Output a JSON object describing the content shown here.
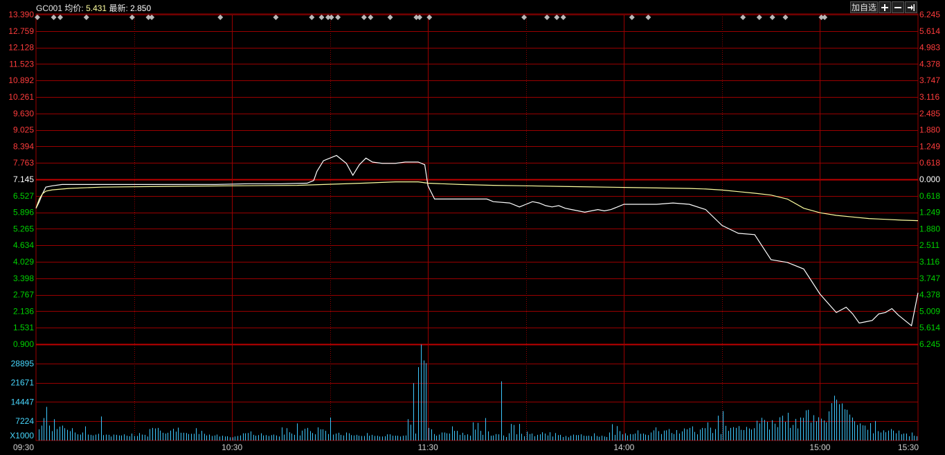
{
  "header": {
    "symbol": "GC001",
    "avg_label": "均价:",
    "avg_value": "5.431",
    "last_label": "最新:",
    "last_value": "2.850"
  },
  "toolbar": {
    "add_watchlist": "加自选",
    "zoom_in_icon": "plus-icon",
    "zoom_out_icon": "minus-icon",
    "goto_end_icon": "arrow-to-end-icon"
  },
  "colors": {
    "grid": "#9a0000",
    "up": "#ff3c3c",
    "down": "#00d200",
    "neutral": "#ffffff",
    "volume": "#3ec8ff",
    "volume_label": "#48d8ff",
    "price_line": "#ffffff",
    "avg_line": "#ffffa0"
  },
  "chart_data": [
    {
      "type": "line",
      "name": "intraday-price",
      "prev_close": 7.145,
      "ylim": [
        0.9,
        13.39
      ],
      "y_ticks_left": [
        "13.390",
        "12.759",
        "12.128",
        "11.523",
        "10.892",
        "10.261",
        "9.630",
        "9.025",
        "8.394",
        "7.763",
        "7.145",
        "6.527",
        "5.896",
        "5.265",
        "4.634",
        "4.029",
        "3.398",
        "2.767",
        "2.136",
        "1.531",
        "0.900"
      ],
      "y_ticks_right": [
        "6.245",
        "5.614",
        "4.983",
        "4.378",
        "3.747",
        "3.116",
        "2.485",
        "1.880",
        "1.249",
        "0.618",
        "0.000",
        "0.618",
        "1.249",
        "1.880",
        "2.511",
        "3.116",
        "3.747",
        "4.378",
        "5.009",
        "5.614",
        "6.245"
      ],
      "x_ticks": [
        "09:30",
        "10:30",
        "11:30",
        "14:00",
        "15:00",
        "15:30"
      ],
      "x_range_minutes": [
        0,
        270
      ],
      "series": [
        {
          "key": "price",
          "x": [
            0,
            1,
            2,
            3,
            5,
            8,
            12,
            18,
            25,
            35,
            45,
            55,
            65,
            75,
            83,
            85,
            86,
            88,
            92,
            95,
            97,
            99,
            101,
            103,
            106,
            110,
            113,
            115,
            117,
            119,
            120,
            122,
            125,
            130,
            135,
            138,
            140,
            145,
            148,
            150,
            152,
            154,
            156,
            158,
            160,
            162,
            164,
            166,
            168,
            170,
            172,
            174,
            176,
            178,
            180,
            182,
            184,
            186,
            188,
            190,
            195,
            200,
            205,
            210,
            215,
            220,
            225,
            230,
            235,
            240,
            245,
            248,
            250,
            252,
            254,
            256,
            258,
            260,
            262,
            264,
            266,
            268,
            270
          ],
          "y": [
            6.05,
            6.3,
            6.6,
            6.85,
            6.9,
            6.95,
            6.95,
            6.95,
            6.95,
            6.95,
            6.95,
            6.95,
            6.98,
            6.98,
            7.0,
            7.1,
            7.45,
            7.85,
            8.05,
            7.75,
            7.3,
            7.7,
            7.95,
            7.8,
            7.75,
            7.75,
            7.8,
            7.8,
            7.8,
            7.7,
            6.9,
            6.4,
            6.4,
            6.4,
            6.4,
            6.4,
            6.3,
            6.25,
            6.1,
            6.2,
            6.3,
            6.25,
            6.15,
            6.1,
            6.15,
            6.05,
            6.0,
            5.95,
            5.9,
            5.95,
            6.0,
            5.95,
            6.0,
            6.1,
            6.2,
            6.2,
            6.2,
            6.2,
            6.2,
            6.2,
            6.25,
            6.2,
            6.0,
            5.4,
            5.1,
            5.05,
            4.1,
            4.0,
            3.75,
            2.8,
            2.1,
            2.3,
            2.05,
            1.7,
            1.75,
            1.8,
            2.05,
            2.1,
            2.25,
            2.0,
            1.8,
            1.6,
            2.85
          ]
        },
        {
          "key": "average",
          "x": [
            0,
            1,
            2,
            3,
            5,
            10,
            20,
            40,
            60,
            80,
            100,
            110,
            115,
            117,
            120,
            130,
            140,
            150,
            160,
            170,
            180,
            190,
            200,
            205,
            210,
            215,
            220,
            225,
            230,
            235,
            240,
            245,
            250,
            255,
            260,
            265,
            270
          ],
          "y": [
            6.05,
            6.4,
            6.6,
            6.7,
            6.75,
            6.8,
            6.85,
            6.88,
            6.9,
            6.92,
            7.0,
            7.05,
            7.05,
            7.05,
            7.0,
            6.95,
            6.92,
            6.9,
            6.88,
            6.86,
            6.84,
            6.82,
            6.8,
            6.78,
            6.74,
            6.68,
            6.62,
            6.55,
            6.4,
            6.05,
            5.88,
            5.78,
            5.72,
            5.66,
            5.63,
            5.6,
            5.58
          ]
        }
      ]
    },
    {
      "type": "bar",
      "name": "volume",
      "ylabel": "X1000",
      "y_ticks": [
        "28895",
        "21671",
        "14447",
        "7224"
      ],
      "ylim": [
        0,
        36119
      ],
      "values": [
        4200,
        5600,
        8400,
        12600,
        5600,
        3500,
        8000,
        4300,
        5200,
        5600,
        4600,
        4000,
        3500,
        4600,
        3000,
        2300,
        2200,
        3000,
        5300,
        2200,
        2100,
        1900,
        2200,
        2500,
        9000,
        2000,
        2200,
        2100,
        1500,
        2200,
        2100,
        1900,
        1900,
        2300,
        1800,
        1600,
        2600,
        1700,
        1700,
        2800,
        2200,
        2100,
        1500,
        4300,
        4700,
        4500,
        4700,
        3700,
        2900,
        2600,
        2900,
        3700,
        4400,
        3300,
        4800,
        2900,
        2900,
        2800,
        2400,
        2500,
        2500,
        4600,
        2400,
        3600,
        2500,
        1900,
        2200,
        1700,
        1900,
        2200,
        1500,
        1800,
        1500,
        1600,
        1200,
        1200,
        1500,
        1700,
        1900,
        2700,
        2700,
        2800,
        3400,
        2100,
        1800,
        2000,
        2700,
        1900,
        2000,
        1700,
        2000,
        2200,
        1900,
        1500,
        4900,
        2200,
        4600,
        3100,
        2600,
        2100,
        6400,
        1900,
        3700,
        4400,
        4700,
        3500,
        2800,
        2300,
        4900,
        4200,
        4200,
        3600,
        2400,
        8600,
        2200,
        2600,
        2900,
        2100,
        1900,
        3000,
        2700,
        2000,
        1900,
        2100,
        1800,
        1700,
        1700,
        2800,
        1800,
        2100,
        1700,
        1800,
        1500,
        1500,
        1600,
        2300,
        2300,
        1800,
        1800,
        1800,
        1500,
        1800,
        1900,
        8000,
        5900,
        21500,
        2600,
        27500,
        36000,
        30000,
        29000,
        4700,
        4200,
        2400,
        1800,
        2200,
        3000,
        3000,
        2700,
        2600,
        5300,
        3600,
        3600,
        2100,
        2900,
        2000,
        2300,
        1800,
        6800,
        4100,
        6600,
        3600,
        2100,
        8400,
        3400,
        1800,
        1900,
        2400,
        2300,
        22200,
        1900,
        1300,
        2700,
        6200,
        5800,
        2300,
        6200,
        2500,
        1600,
        3300,
        2400,
        2600,
        1600,
        2100,
        2300,
        3100,
        2600,
        1900,
        3100,
        1500,
        2800,
        2000,
        2100,
        1300,
        1700,
        1200,
        1800,
        2200,
        2000,
        2000,
        2300,
        1800,
        1700,
        1800,
        1600,
        2700,
        1700,
        1400,
        1800,
        1500,
        1300,
        3000,
        6100,
        2100,
        5400,
        3500,
        2300,
        2700,
        1900,
        2400,
        2300,
        2600,
        3800,
        2500,
        2600,
        2200,
        2000,
        3000,
        3800,
        4900,
        3500,
        2400,
        3700,
        3800,
        4300,
        2800,
        2400,
        3900,
        2600,
        3400,
        4500,
        4200,
        4700,
        5300,
        3200,
        2300,
        4100,
        4700,
        4600,
        6800,
        4800,
        2800,
        4300,
        9300,
        2400,
        11000,
        5500,
        3600,
        4700,
        5000,
        4700,
        5400,
        4000,
        3900,
        5100,
        4500,
        4100,
        4600,
        7400,
        6400,
        8500,
        7700,
        7000,
        4100,
        7600,
        6300,
        5000,
        8700,
        9300,
        7000,
        10400,
        4700,
        5800,
        8100,
        4500,
        8600,
        8500,
        11300,
        11500,
        6700,
        9500,
        7200,
        8700,
        8200,
        7500,
        6800,
        10900,
        14000,
        16800,
        15300,
        13600,
        13900,
        11700,
        11500,
        9700,
        8600,
        7200,
        5800,
        6400,
        5700,
        5600,
        4000,
        6500,
        2700,
        7300,
        3500,
        3000,
        3800,
        3100,
        3700,
        4300,
        3700,
        2700,
        3700,
        2300,
        2600,
        2600,
        1600,
        3000,
        1800,
        1600
      ]
    }
  ],
  "trade_markers_minutes": [
    0,
    5,
    7,
    15,
    29,
    34,
    35,
    56,
    73,
    84,
    87,
    89,
    90,
    92,
    100,
    102,
    108,
    116,
    117,
    120,
    149,
    156,
    159,
    161,
    182,
    187,
    216,
    221,
    225,
    229,
    240,
    241
  ]
}
